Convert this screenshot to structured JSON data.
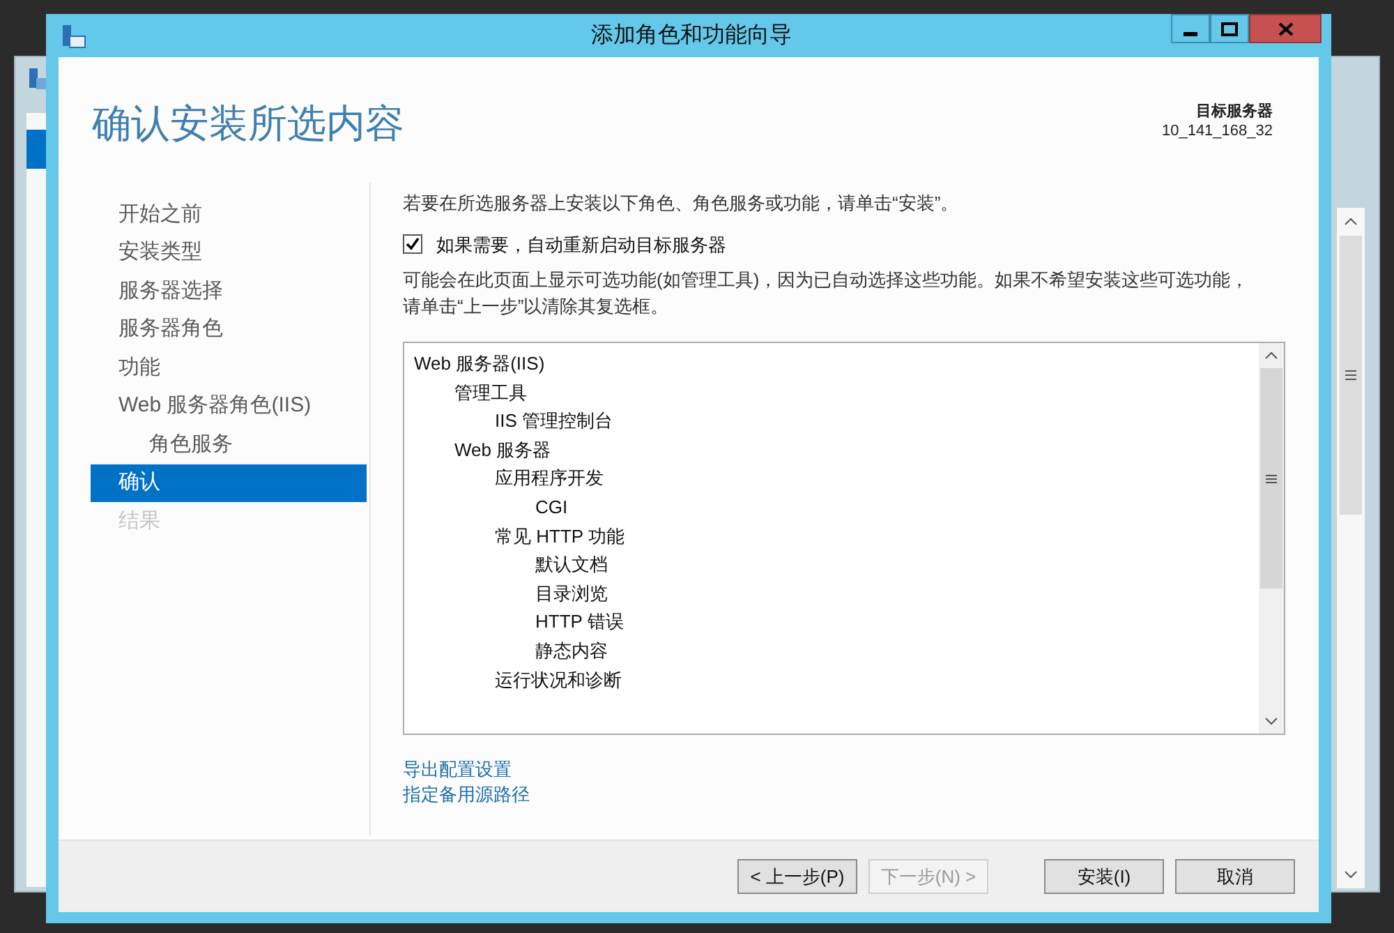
{
  "window": {
    "title": "添加角色和功能向导"
  },
  "header": {
    "title": "确认安装所选内容",
    "target_label": "目标服务器",
    "target_value": "10_141_168_32"
  },
  "sidebar": {
    "items": [
      {
        "label": "开始之前",
        "selected": false,
        "disabled": false
      },
      {
        "label": "安装类型",
        "selected": false,
        "disabled": false
      },
      {
        "label": "服务器选择",
        "selected": false,
        "disabled": false
      },
      {
        "label": "服务器角色",
        "selected": false,
        "disabled": false
      },
      {
        "label": "功能",
        "selected": false,
        "disabled": false
      },
      {
        "label": "Web 服务器角色(IIS)",
        "selected": false,
        "disabled": false,
        "children": [
          {
            "label": "角色服务",
            "selected": false,
            "disabled": false
          }
        ]
      },
      {
        "label": "确认",
        "selected": true,
        "disabled": false
      },
      {
        "label": "结果",
        "selected": false,
        "disabled": true
      }
    ]
  },
  "content": {
    "intro": "若要在所选服务器上安装以下角色、角色服务或功能，请单击“安装”。",
    "restart_option": {
      "label": "如果需要，自动重新启动目标服务器",
      "checked": true
    },
    "note": "可能会在此页面上显示可选功能(如管理工具)，因为已自动选择这些功能。如果不希望安装这些可选功能，请单击“上一步”以清除其复选框。",
    "tree": [
      {
        "label": "Web 服务器(IIS)",
        "children": [
          {
            "label": "管理工具",
            "children": [
              {
                "label": "IIS 管理控制台"
              }
            ]
          },
          {
            "label": "Web 服务器",
            "children": [
              {
                "label": "应用程序开发",
                "children": [
                  {
                    "label": "CGI"
                  }
                ]
              },
              {
                "label": "常见 HTTP 功能",
                "children": [
                  {
                    "label": "默认文档"
                  },
                  {
                    "label": "目录浏览"
                  },
                  {
                    "label": "HTTP 错误"
                  },
                  {
                    "label": "静态内容"
                  }
                ]
              },
              {
                "label": "运行状况和诊断"
              }
            ]
          }
        ]
      }
    ],
    "links": [
      "导出配置设置",
      "指定备用源路径"
    ]
  },
  "buttons": [
    {
      "label": "< 上一步(P)",
      "disabled": false
    },
    {
      "label": "下一步(N) >",
      "disabled": true
    },
    {
      "label": "安装(I)",
      "disabled": false
    },
    {
      "label": "取消",
      "disabled": false
    }
  ]
}
